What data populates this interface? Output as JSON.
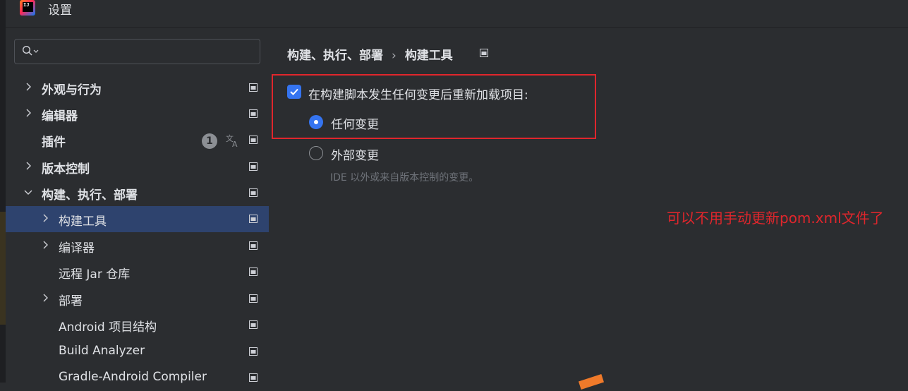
{
  "window": {
    "title": "设置",
    "logo_text": "IJ"
  },
  "search": {
    "value": "",
    "placeholder": ""
  },
  "sidebar": {
    "items": [
      {
        "label": "外观与行为",
        "expandable": true,
        "expanded": false,
        "bold": true
      },
      {
        "label": "编辑器",
        "expandable": true,
        "expanded": false,
        "bold": true
      },
      {
        "label": "插件",
        "expandable": false,
        "bold": true,
        "badge": "1"
      },
      {
        "label": "版本控制",
        "expandable": true,
        "expanded": false,
        "bold": true
      },
      {
        "label": "构建、执行、部署",
        "expandable": true,
        "expanded": true,
        "bold": true
      },
      {
        "label": "构建工具",
        "expandable": true,
        "expanded": false,
        "selected": true
      },
      {
        "label": "编译器",
        "expandable": true,
        "expanded": false
      },
      {
        "label": "远程 Jar 仓库",
        "expandable": false
      },
      {
        "label": "部署",
        "expandable": true,
        "expanded": false
      },
      {
        "label": "Android 项目结构",
        "expandable": false
      },
      {
        "label": "Build Analyzer",
        "expandable": false
      },
      {
        "label": "Gradle-Android Compiler",
        "expandable": false
      }
    ]
  },
  "breadcrumb": {
    "parent": "构建、执行、部署",
    "separator": "›",
    "current": "构建工具"
  },
  "settings": {
    "reload_checkbox_label": "在构建脚本发生任何变更后重新加载项目:",
    "reload_checked": true,
    "options": [
      {
        "label": "任何变更",
        "selected": true
      },
      {
        "label": "外部变更",
        "selected": false
      }
    ],
    "external_hint": "IDE 以外或来自版本控制的变更。"
  },
  "annotation": {
    "text": "可以不用手动更新pom.xml文件了",
    "color": "#e0262c"
  },
  "colors": {
    "accent": "#3574f0",
    "selection": "#2e436e",
    "background": "#2b2d30"
  }
}
